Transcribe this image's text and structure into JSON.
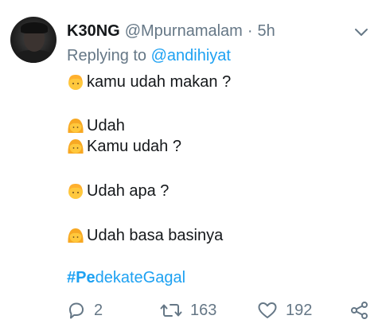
{
  "tweet": {
    "display_name": "K30NG",
    "handle": "@Mpurnamalam",
    "separator": "·",
    "time": "5h",
    "replying_prefix": "Replying to",
    "replying_to": "@andihiyat",
    "lines": [
      {
        "emoji": "boy-emoji",
        "text": "kamu udah makan ?"
      },
      {
        "emoji": "girl-emoji",
        "text": "Udah"
      },
      {
        "emoji": "girl-emoji",
        "text": "Kamu udah ?"
      },
      {
        "emoji": "boy-emoji",
        "text": "Udah apa ?"
      },
      {
        "emoji": "girl-emoji",
        "text": "Udah basa basinya"
      }
    ],
    "hashtag_bold": "#Pe",
    "hashtag_rest": "dekateGagal",
    "actions": {
      "reply_count": "2",
      "retweet_count": "163",
      "like_count": "192"
    }
  },
  "colors": {
    "text": "#14171a",
    "muted": "#657786",
    "link": "#1da1f2",
    "emoji_skin": "#ffc83d",
    "emoji_hair_boy": "#ffb02e",
    "emoji_hair_girl": "#f7a823"
  },
  "icons": [
    "chevron-down-icon",
    "reply-icon",
    "retweet-icon",
    "like-icon",
    "share-icon"
  ]
}
